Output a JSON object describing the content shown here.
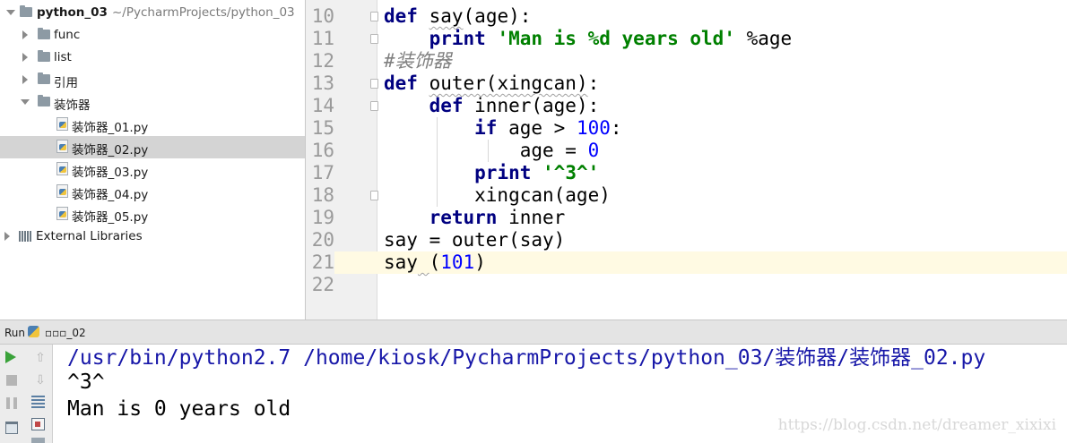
{
  "project_tree": {
    "root": {
      "name": "python_03",
      "path": "~/PycharmProjects/python_03"
    },
    "folders": [
      "func",
      "list",
      "引用",
      "装饰器"
    ],
    "files": [
      "装饰器_01.py",
      "装饰器_02.py",
      "装饰器_03.py",
      "装饰器_04.py",
      "装饰器_05.py"
    ],
    "external": "External Libraries"
  },
  "editor": {
    "line_numbers": [
      "10",
      "11",
      "12",
      "13",
      "14",
      "15",
      "16",
      "17",
      "18",
      "19",
      "20",
      "21",
      "22"
    ],
    "current_line": "21",
    "lines": [
      [
        {
          "t": "def",
          "c": "kw"
        },
        {
          "t": " "
        },
        {
          "t": "say",
          "c": "squig"
        },
        {
          "t": "(age):"
        }
      ],
      [
        {
          "t": "    "
        },
        {
          "t": "print",
          "c": "kw"
        },
        {
          "t": " "
        },
        {
          "t": "'Man is %d years old'",
          "c": "str"
        },
        {
          "t": " %age"
        }
      ],
      [
        {
          "t": "#装饰器",
          "c": "cmt"
        }
      ],
      [
        {
          "t": "def",
          "c": "kw"
        },
        {
          "t": " "
        },
        {
          "t": "outer(xingcan)",
          "c": "squig"
        },
        {
          "t": ":"
        }
      ],
      [
        {
          "t": "    "
        },
        {
          "t": "def",
          "c": "kw"
        },
        {
          "t": " inner(age):"
        }
      ],
      [
        {
          "t": "        "
        },
        {
          "t": "if",
          "c": "kw"
        },
        {
          "t": " age > "
        },
        {
          "t": "100",
          "c": "num"
        },
        {
          "t": ":"
        }
      ],
      [
        {
          "t": "            age = "
        },
        {
          "t": "0",
          "c": "num"
        }
      ],
      [
        {
          "t": "        "
        },
        {
          "t": "print",
          "c": "kw"
        },
        {
          "t": " "
        },
        {
          "t": "'^3^'",
          "c": "str"
        }
      ],
      [
        {
          "t": "        xingcan(age)"
        }
      ],
      [
        {
          "t": "    "
        },
        {
          "t": "return",
          "c": "kw"
        },
        {
          "t": " inner"
        }
      ],
      [
        {
          "t": "say = outer(say)"
        }
      ],
      [
        {
          "t": "say"
        },
        {
          "t": " ",
          "c": "squig"
        },
        {
          "t": "("
        },
        {
          "t": "101",
          "c": "num"
        },
        {
          "t": ")"
        }
      ],
      []
    ]
  },
  "run": {
    "label": "Run",
    "config": "▫▫▫_02",
    "output": [
      {
        "text": "/usr/bin/python2.7 /home/kiosk/PycharmProjects/python_03/装饰器/装饰器_02.py",
        "kind": "cmd"
      },
      {
        "text": "^3^",
        "kind": "std"
      },
      {
        "text": "Man is 0 years old",
        "kind": "std"
      }
    ]
  },
  "watermark": "https://blog.csdn.net/dreamer_xixixi",
  "colors": {
    "keyword": "#000080",
    "string": "#008000",
    "number": "#0000ff",
    "comment": "#808080",
    "console_command": "#1717a8",
    "current_line": "#fffae3",
    "selected_row": "#d4d4d4"
  }
}
